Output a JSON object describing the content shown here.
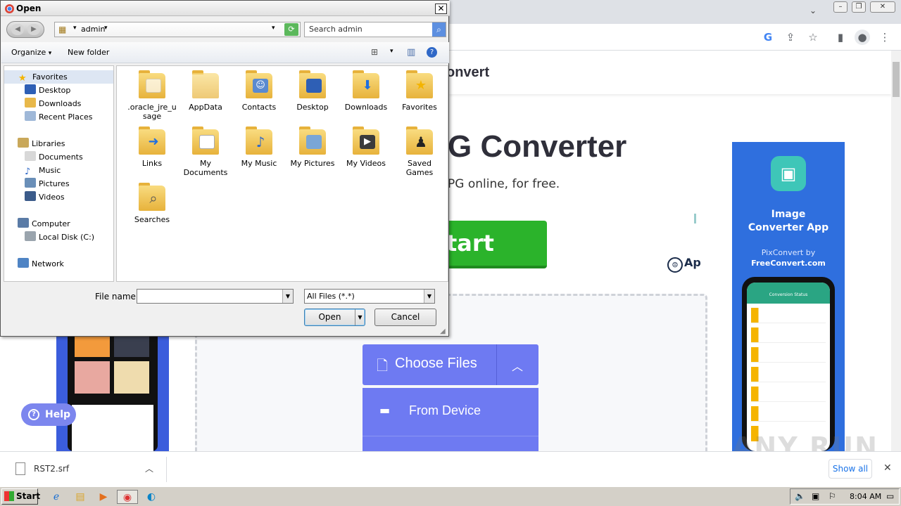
{
  "browser": {
    "site_title": "onvert",
    "hero_title": "G Converter",
    "hero_subtitle": "PG online, for free.",
    "start_label": "tart",
    "badge_text": "Ap",
    "choose_files_label": "Choose Files",
    "from_device_label": "From Device",
    "help_label": "Help",
    "ad": {
      "title_line1": "Image",
      "title_line2": "Converter App",
      "by_line1": "PixConvert by",
      "by_line2": "FreeConvert.com",
      "phone_header": "Conversion Status"
    },
    "download_file": "RST2.srf",
    "show_all_label": "Show all"
  },
  "dialog": {
    "title": "Open",
    "address": "admin",
    "search_placeholder": "Search admin",
    "toolbar": {
      "organize": "Organize",
      "new_folder": "New folder"
    },
    "nav": {
      "favorites": "Favorites",
      "desktop": "Desktop",
      "downloads": "Downloads",
      "recent_places": "Recent Places",
      "libraries": "Libraries",
      "documents": "Documents",
      "music": "Music",
      "pictures": "Pictures",
      "videos": "Videos",
      "computer": "Computer",
      "local_disk": "Local Disk (C:)",
      "network": "Network"
    },
    "files": [
      {
        "name": ".oracle_jre_usage",
        "line1": ".oracle_jre_u",
        "line2": "sage",
        "icon": "folder-icon"
      },
      {
        "name": "AppData",
        "line1": "AppData",
        "line2": "",
        "icon": "folder-icon"
      },
      {
        "name": "Contacts",
        "line1": "Contacts",
        "line2": "",
        "icon": "contacts-folder-icon"
      },
      {
        "name": "Desktop",
        "line1": "Desktop",
        "line2": "",
        "icon": "desktop-folder-icon"
      },
      {
        "name": "Downloads",
        "line1": "Downloads",
        "line2": "",
        "icon": "downloads-folder-icon"
      },
      {
        "name": "Favorites",
        "line1": "Favorites",
        "line2": "",
        "icon": "favorites-folder-icon"
      },
      {
        "name": "Links",
        "line1": "Links",
        "line2": "",
        "icon": "links-folder-icon"
      },
      {
        "name": "My Documents",
        "line1": "My",
        "line2": "Documents",
        "icon": "documents-folder-icon"
      },
      {
        "name": "My Music",
        "line1": "My Music",
        "line2": "",
        "icon": "music-folder-icon"
      },
      {
        "name": "My Pictures",
        "line1": "My Pictures",
        "line2": "",
        "icon": "pictures-folder-icon"
      },
      {
        "name": "My Videos",
        "line1": "My Videos",
        "line2": "",
        "icon": "videos-folder-icon"
      },
      {
        "name": "Saved Games",
        "line1": "Saved",
        "line2": "Games",
        "icon": "saved-games-folder-icon"
      },
      {
        "name": "Searches",
        "line1": "Searches",
        "line2": "",
        "icon": "searches-folder-icon"
      }
    ],
    "file_name_label": "File name:",
    "file_name_value": "",
    "file_type": "All Files (*.*)",
    "open_label": "Open",
    "cancel_label": "Cancel"
  },
  "taskbar": {
    "start_label": "Start",
    "time": "8:04 AM"
  },
  "watermark": "ANY RUN"
}
